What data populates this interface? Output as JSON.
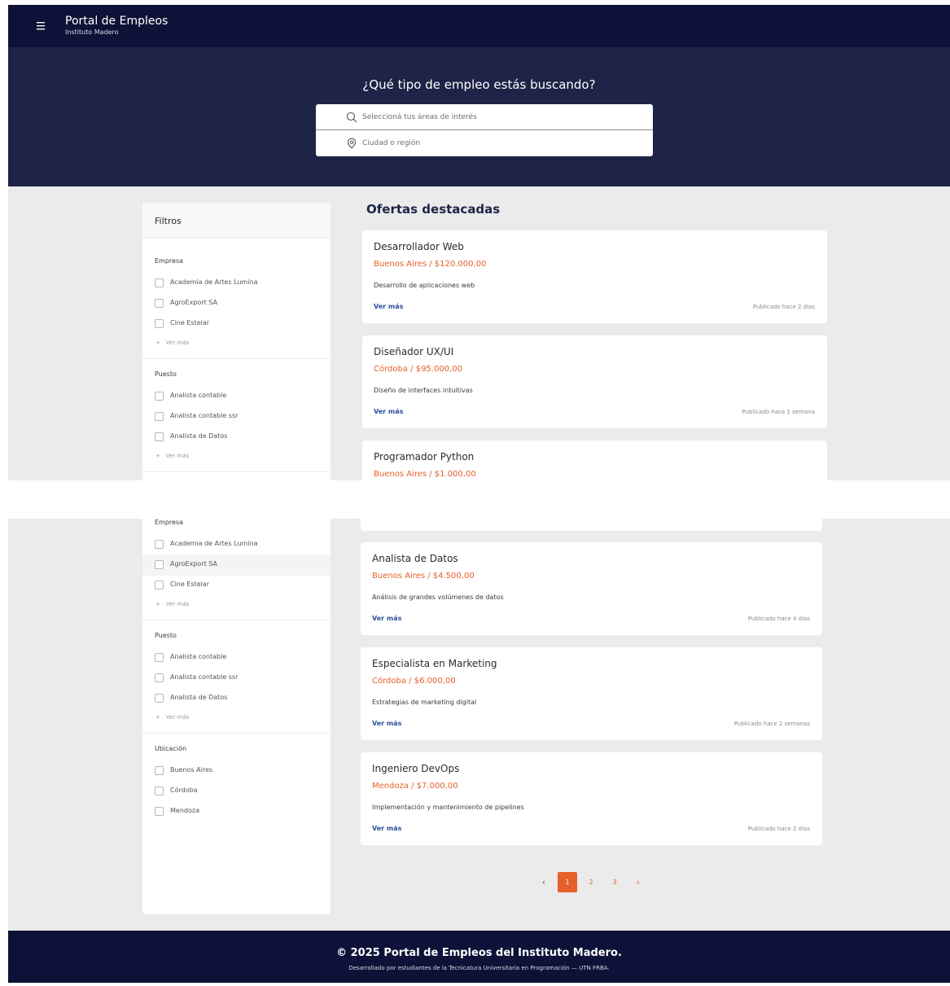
{
  "header": {
    "title": "Portal de Empleos",
    "subtitle": "Instituto Madero",
    "menu_icon": "hamburger-menu-icon"
  },
  "hero": {
    "question": "¿Qué tipo de empleo estás buscando?",
    "area_placeholder": "Seleccioná tus áreas de interés",
    "area_icon": "search-icon",
    "location_placeholder": "Ciudad o región",
    "location_icon": "location-pin-icon"
  },
  "filters": {
    "title": "Filtros",
    "more_label": "Ver más",
    "empresa": {
      "label": "Empresa",
      "options": [
        "Academia de Artes Lumina",
        "AgroExport SA",
        "Cine Estelar"
      ]
    },
    "puesto": {
      "label": "Puesto",
      "options": [
        "Analista contable",
        "Analista contable ssr",
        "Analista de Datos"
      ]
    },
    "ubicacion": {
      "label": "Ubicación",
      "options": [
        "Buenos Aires",
        "Córdoba",
        "Mendoza"
      ]
    }
  },
  "main": {
    "title": "Ofertas destacadas",
    "see_more_label": "Ver más",
    "jobs": [
      {
        "title": "Desarrollador Web",
        "location_salary": "Buenos Aires / $120.000,00",
        "description": "Desarrollo de aplicaciones web",
        "posted": "Publicado hace 2 días"
      },
      {
        "title": "Diseñador UX/UI",
        "location_salary": "Córdoba / $95.000,00",
        "description": "Diseño de interfaces intuitivas",
        "posted": "Publicado hace 1 semana"
      },
      {
        "title": "Programador Python",
        "location_salary": "Buenos Aires / $1.000,00",
        "description": "",
        "posted": ""
      },
      {
        "title": "Analista de Datos",
        "location_salary": "Buenos Aires / $4.500,00",
        "description": "Análisis de grandes volúmenes de datos",
        "posted": "Publicado hace 4 días"
      },
      {
        "title": "Especialista en Marketing",
        "location_salary": "Córdoba / $6.000,00",
        "description": "Estrategias de marketing digital",
        "posted": "Publicado hace 2 semanas"
      },
      {
        "title": "Ingeniero DevOps",
        "location_salary": "Mendoza / $7.000,00",
        "description": "Implementación y mantenimiento de pipelines",
        "posted": "Publicado hace 2 días"
      }
    ]
  },
  "pagination": {
    "prev": "‹",
    "pages": [
      "1",
      "2",
      "3"
    ],
    "current": "1",
    "next": "›"
  },
  "footer": {
    "title": "© 2025 Portal de Empleos del Instituto Madero.",
    "subtitle": "Desarrollado por estudiantes de la Tecnicatura Universitaria en Programación — UTN FRBA."
  },
  "colors": {
    "navy": "#0e1238",
    "hero": "#1e2447",
    "accent": "#e5602a",
    "link": "#2a4e9a",
    "background": "#ebebeb"
  }
}
